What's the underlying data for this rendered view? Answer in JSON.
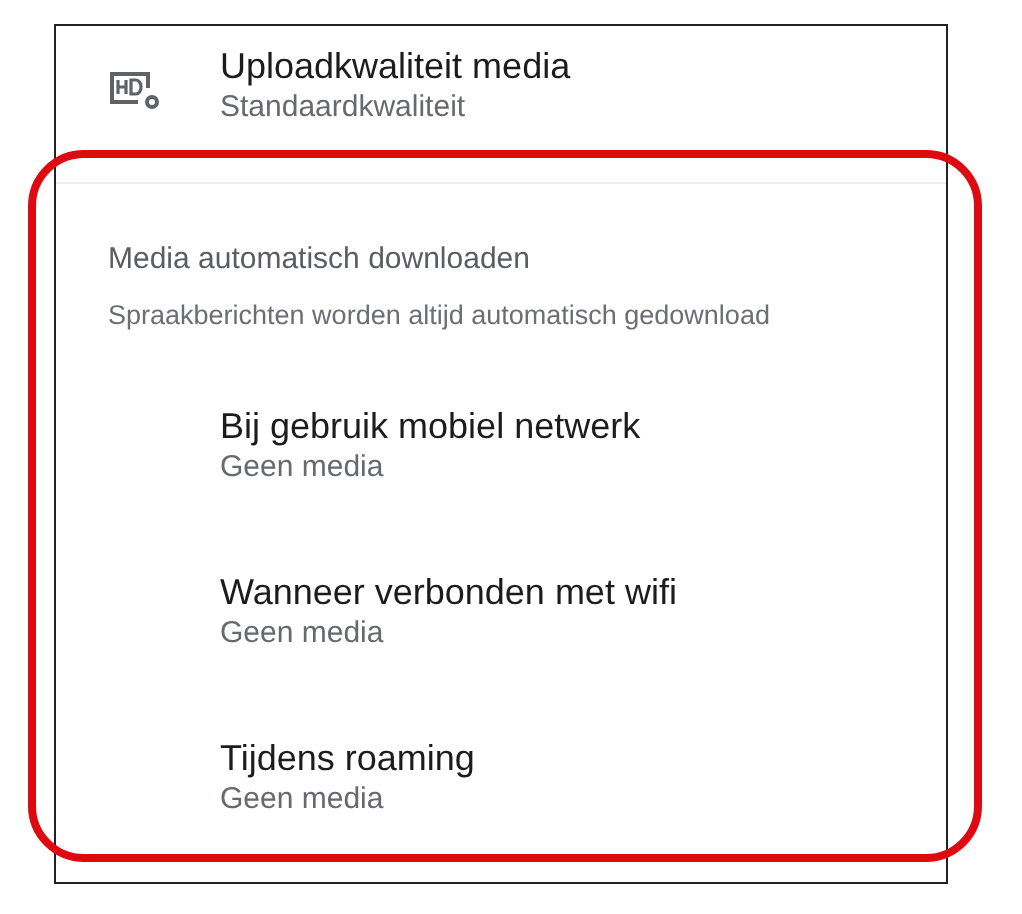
{
  "top_item": {
    "title": "Uploadkwaliteit media",
    "subtitle": "Standaardkwaliteit"
  },
  "section": {
    "header": "Media automatisch downloaden",
    "description": "Spraakberichten worden altijd automatisch gedownload",
    "items": [
      {
        "title": "Bij gebruik mobiel netwerk",
        "subtitle": "Geen media"
      },
      {
        "title": "Wanneer verbonden met wifi",
        "subtitle": "Geen media"
      },
      {
        "title": "Tijdens roaming",
        "subtitle": "Geen media"
      }
    ]
  },
  "annotation": {
    "kind": "highlight"
  }
}
